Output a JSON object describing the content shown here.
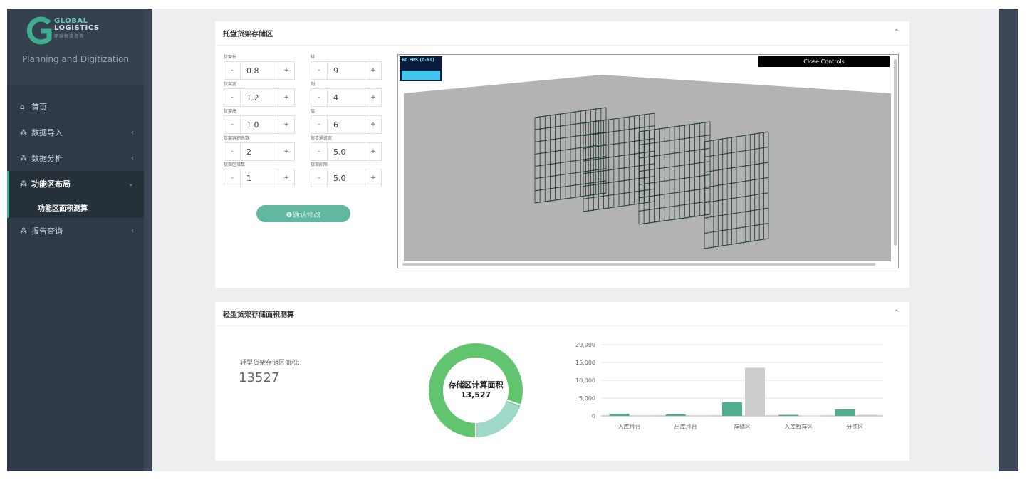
{
  "brand": {
    "line1": "GLOBAL",
    "line2": "LOGISTICS",
    "line3": "环球物流咨询",
    "subtitle": "Planning and Digitization",
    "color_primary": "#3fae8f"
  },
  "sidebar": {
    "items": [
      {
        "label": "首页",
        "icon": "home-icon"
      },
      {
        "label": "数据导入",
        "icon": "sitemap-icon",
        "chevron": "‹"
      },
      {
        "label": "数据分析",
        "icon": "sitemap-icon",
        "chevron": "‹"
      },
      {
        "label": "功能区布局",
        "icon": "sitemap-icon",
        "chevron": "⌄",
        "expanded": true,
        "children": [
          {
            "label": "功能区面积测算"
          }
        ]
      },
      {
        "label": "报告查询",
        "icon": "sitemap-icon",
        "chevron": "‹"
      }
    ]
  },
  "pallet_panel": {
    "title": "托盘货架存储区",
    "collapse": "^",
    "fields": [
      {
        "label": "货架长",
        "value": "0.8"
      },
      {
        "label": "货架宽",
        "value": "1.2"
      },
      {
        "label": "货架高",
        "value": "1.0"
      },
      {
        "label": "货架容积系数",
        "value": "2"
      },
      {
        "label": "货架区域数",
        "value": "1"
      },
      {
        "label": "排",
        "value": "9"
      },
      {
        "label": "列",
        "value": "4"
      },
      {
        "label": "层",
        "value": "6"
      },
      {
        "label": "拣货通道宽",
        "value": "5.0"
      },
      {
        "label": "货架间隙",
        "value": "5.0"
      }
    ],
    "minus": "-",
    "plus": "+",
    "confirm_label": "❶确认修改",
    "viewport": {
      "fps_text": "60 FPS (0-61)",
      "close_controls": "Close Controls"
    }
  },
  "light_panel": {
    "title": "轻型货架存储面积测算",
    "collapse": "^",
    "area_label": "轻型货架存储区面积:",
    "area_value": "13527",
    "donut_title": "存储区计算面积",
    "donut_value": "13,527"
  },
  "chart_data": {
    "type": "bar",
    "categories": [
      "入库月台",
      "出库月台",
      "存储区",
      "入库暂存区",
      "分拣区"
    ],
    "series": [
      {
        "values": [
          600,
          400,
          3800,
          300,
          1800
        ],
        "color": "#4fae8e"
      },
      {
        "values": [
          150,
          150,
          13527,
          100,
          300
        ],
        "color": "#cccccc"
      }
    ],
    "ylim": [
      0,
      20000
    ],
    "yticks": [
      "0",
      "5,000",
      "10,000",
      "15,000",
      "20,000"
    ],
    "grid": true
  }
}
